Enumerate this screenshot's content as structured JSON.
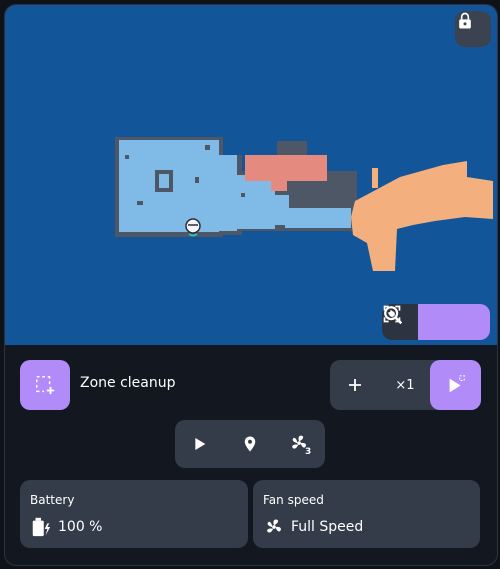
{
  "map": {
    "colors": {
      "background": "#125699",
      "room_blue": "#7fbbe6",
      "room_red": "#e58a7e",
      "room_orange": "#f3b07e",
      "wall": "#4d5766"
    },
    "icons": {
      "lock": "lock-icon",
      "focus": "focus-icon",
      "zoom_out": "zoom-out-icon",
      "zoom_in": "zoom-in-icon"
    }
  },
  "zone": {
    "label": "Zone cleanup",
    "repeat": "×1",
    "icons": {
      "zone": "select-area-icon",
      "add": "plus-icon",
      "start": "play-zone-icon"
    }
  },
  "actions": {
    "icons": [
      "play-icon",
      "location-pin-icon",
      "fan-icon"
    ],
    "fan_badge": "3"
  },
  "battery": {
    "title": "Battery",
    "value": "100 %",
    "icon": "battery-charging-icon"
  },
  "fan_speed": {
    "title": "Fan speed",
    "value": "Full Speed",
    "icon": "fan-icon"
  },
  "colors": {
    "accent": "#b18cf8",
    "panel": "#353c49",
    "card": "#131820"
  }
}
